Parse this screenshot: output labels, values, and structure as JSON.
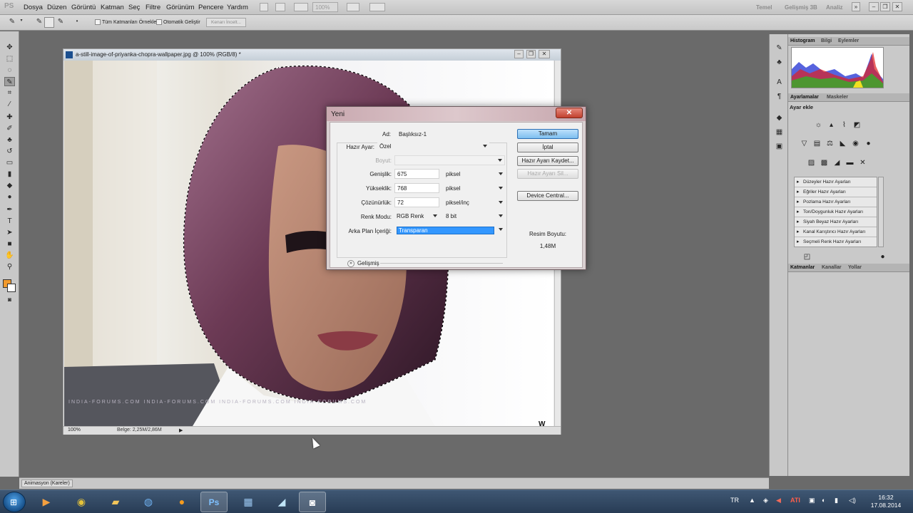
{
  "menubar": {
    "logo": "PS",
    "items": [
      "Dosya",
      "Düzen",
      "Görüntü",
      "Katman",
      "Seç",
      "Filtre",
      "Görünüm",
      "Pencere",
      "Yardım"
    ],
    "zoom": "100%",
    "workspaces": [
      "Temel",
      "Gelişmiş 3B",
      "Analiz"
    ],
    "window_controls": [
      "minimize",
      "restore",
      "close"
    ]
  },
  "options_bar": {
    "sample_all_layers": "Tüm Katmanları Örnekle",
    "auto_enhance": "Otomatik Geliştir",
    "refine_edge": "Kenarı İncelt..."
  },
  "document": {
    "title": "a-still-image-of-priyanka-chopra-wallpaper.jpg @ 100% (RGB/8) *",
    "zoom": "100%",
    "doc_size": "Belge: 2,25M/2,86M",
    "watermark": "INDIA-FORUMS.COM       INDIA-FORUMS.COM       INDIA-FORUMS.COM       INDIA-FORUMS.COM",
    "logo": "W"
  },
  "dialog": {
    "title": "Yeni",
    "name_label": "Ad:",
    "name_value": "Başlıksız-1",
    "preset_label": "Hazır Ayar:",
    "preset_value": "Özel",
    "size_label": "Boyut:",
    "width_label": "Genişlik:",
    "width_value": "675",
    "width_unit": "piksel",
    "height_label": "Yükseklik:",
    "height_value": "768",
    "height_unit": "piksel",
    "resolution_label": "Çözünürlük:",
    "resolution_value": "72",
    "resolution_unit": "piksel/inç",
    "color_mode_label": "Renk Modu:",
    "color_mode_value": "RGB Renk",
    "bit_depth": "8 bit",
    "background_label": "Arka Plan İçeriği:",
    "background_value": "Transparan",
    "advanced": "Gelişmiş",
    "buttons": {
      "ok": "Tamam",
      "cancel": "İptal",
      "save_preset": "Hazır Ayarı Kaydet...",
      "delete_preset": "Hazır Ayarı Sil...",
      "device_central": "Device Central..."
    },
    "image_size_label": "Resim Boyutu:",
    "image_size_value": "1,48M"
  },
  "panels": {
    "top_tabs": [
      "Histogram",
      "Bilgi",
      "Eylemler"
    ],
    "adj_tabs": [
      "Ayarlamalar",
      "Maskeler"
    ],
    "add_adjustment": "Ayar ekle",
    "presets": [
      "Düzeyler Hazır Ayarları",
      "Eğriler Hazır Ayarları",
      "Pozlama Hazır Ayarları",
      "Ton/Doygunluk Hazır Ayarları",
      "Siyah Beyaz Hazır Ayarları",
      "Kanal Karıştırıcı Hazır Ayarları",
      "Seçmeli Renk Hazır Ayarları"
    ],
    "layer_tabs": [
      "Katmanlar",
      "Kanallar",
      "Yollar"
    ]
  },
  "anim_bar": {
    "tab": "Animasyon (Kareler)"
  },
  "taskbar": {
    "language": "TR",
    "time": "16:32",
    "date": "17.08.2014",
    "apps": [
      "media-player-icon",
      "chrome-icon",
      "folder-icon",
      "firefox-icon",
      "orange-app-icon",
      "photoshop-icon",
      "movie-maker-icon",
      "paint-icon",
      "camera-icon"
    ]
  },
  "colors": {
    "foreground": "#f19a2e",
    "background": "#ffffff",
    "selection": "#3397ff",
    "dialog_tint": "#d8cfd0"
  }
}
